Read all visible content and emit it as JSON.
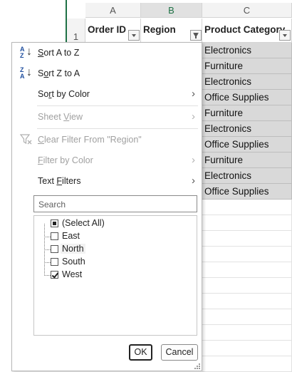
{
  "sheet": {
    "columns": [
      {
        "letter": "A",
        "header": "Order ID",
        "selected": false
      },
      {
        "letter": "B",
        "header": "Region",
        "selected": true
      },
      {
        "letter": "C",
        "header": "Product Category",
        "selected": false
      }
    ],
    "row_number": "1",
    "category_values": [
      "Electronics",
      "Furniture",
      "Electronics",
      "Office Supplies",
      "Furniture",
      "Electronics",
      "Office Supplies",
      "Furniture",
      "Electronics",
      "Office Supplies"
    ]
  },
  "menu": {
    "sort_az": "Sort A to Z",
    "sort_za": "Sort Z to A",
    "sort_by_color": "Sort by Color",
    "sheet_view": "Sheet View",
    "clear_filter": "Clear Filter From \"Region\"",
    "filter_by_color": "Filter by Color",
    "text_filters": "Text Filters",
    "search_placeholder": "Search",
    "items": [
      {
        "label": "(Select All)",
        "state": "mixed"
      },
      {
        "label": "East",
        "state": "unchecked"
      },
      {
        "label": "North",
        "state": "unchecked"
      },
      {
        "label": "South",
        "state": "unchecked"
      },
      {
        "label": "West",
        "state": "checked"
      }
    ],
    "ok": "OK",
    "cancel": "Cancel"
  },
  "icons": {
    "sort_az": "sort-ascending-icon",
    "sort_za": "sort-descending-icon",
    "clear_filter": "clear-filter-icon",
    "submenu": "chevron-right-icon"
  },
  "colors": {
    "accent_green": "#1e7145",
    "selected_range": "#d9d9d9",
    "sort_letters": "#1f4e9e"
  }
}
